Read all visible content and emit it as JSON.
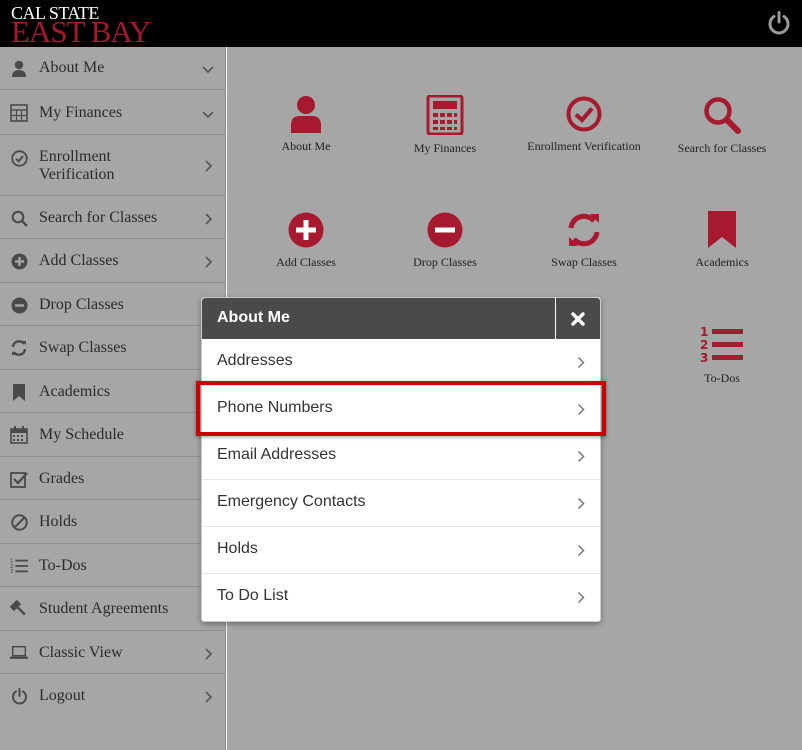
{
  "header": {
    "logo_line1": "CAL STATE",
    "logo_line2": "EAST BAY",
    "power_icon": "power-icon"
  },
  "colors": {
    "brand_red": "#a6192e",
    "sidebar_bg": "#a6a6a6",
    "header_bg": "#000000",
    "modal_header": "#4a4a4a",
    "highlight": "#cc0000"
  },
  "sidebar": {
    "items": [
      {
        "label": "About Me",
        "icon": "user-icon",
        "chevron": "down"
      },
      {
        "label": "My Finances",
        "icon": "calculator-icon",
        "chevron": "down"
      },
      {
        "label": "Enrollment\nVerification",
        "icon": "check-circle-icon",
        "chevron": "right"
      },
      {
        "label": "Search for Classes",
        "icon": "search-icon",
        "chevron": "right"
      },
      {
        "label": "Add Classes",
        "icon": "plus-circle-icon",
        "chevron": "right"
      },
      {
        "label": "Drop Classes",
        "icon": "minus-circle-icon",
        "chevron": "none"
      },
      {
        "label": "Swap Classes",
        "icon": "swap-icon",
        "chevron": "none"
      },
      {
        "label": "Academics",
        "icon": "bookmark-icon",
        "chevron": "none"
      },
      {
        "label": "My Schedule",
        "icon": "calendar-icon",
        "chevron": "none"
      },
      {
        "label": "Grades",
        "icon": "checkbox-icon",
        "chevron": "none"
      },
      {
        "label": "Holds",
        "icon": "ban-icon",
        "chevron": "none"
      },
      {
        "label": "To-Dos",
        "icon": "numbered-list-icon",
        "chevron": "none"
      },
      {
        "label": "Student Agreements",
        "icon": "gavel-icon",
        "chevron": "none"
      },
      {
        "label": "Classic View",
        "icon": "laptop-icon",
        "chevron": "right"
      },
      {
        "label": "Logout",
        "icon": "power-icon",
        "chevron": "right"
      }
    ]
  },
  "tiles": [
    {
      "label": "About Me",
      "icon": "user-icon"
    },
    {
      "label": "My Finances",
      "icon": "calculator-icon"
    },
    {
      "label": "Enrollment Verification",
      "icon": "check-circle-icon"
    },
    {
      "label": "Search for Classes",
      "icon": "search-icon"
    },
    {
      "label": "Add Classes",
      "icon": "plus-circle-icon"
    },
    {
      "label": "Drop Classes",
      "icon": "minus-circle-icon"
    },
    {
      "label": "Swap Classes",
      "icon": "swap-icon"
    },
    {
      "label": "Academics",
      "icon": "bookmark-icon"
    },
    {
      "label": "To-Dos",
      "icon": "numbered-list-icon"
    }
  ],
  "modal": {
    "title": "About Me",
    "close_icon": "close-icon",
    "items": [
      {
        "label": "Addresses"
      },
      {
        "label": "Phone Numbers",
        "highlighted": true
      },
      {
        "label": "Email Addresses"
      },
      {
        "label": "Emergency Contacts"
      },
      {
        "label": "Holds"
      },
      {
        "label": "To Do List"
      }
    ]
  }
}
